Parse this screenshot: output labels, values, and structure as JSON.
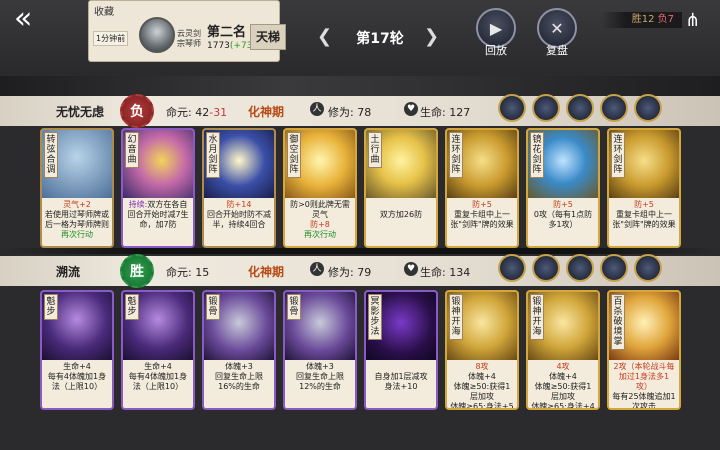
{
  "top": {
    "fav_label": "收藏",
    "time_ago": "1分钟前",
    "sect": "云灵剑宗琴师",
    "rank": "第二名",
    "score": "1773",
    "score_delta": "(+73)",
    "ladder": "天梯",
    "round": "第17轮",
    "replay_label": "回放",
    "review_label": "复盘",
    "record_win": "胜12",
    "record_loss": "负7"
  },
  "players": [
    {
      "name": "无忧无虑",
      "result": "负",
      "life_label": "命元:",
      "life": "42",
      "life_loss": "-31",
      "realm": "化神期",
      "cult_label": "修为:",
      "cult": "78",
      "hp_label": "生命:",
      "hp": "127",
      "cards": [
        {
          "name": "转弦合调",
          "d1": "灵气+2",
          "d2": "若使用过琴师牌或后一格为琴师牌则",
          "d3": "再次行动"
        },
        {
          "name": "幻音曲",
          "d1": "持续:",
          "d2": "双方在各自回合开始时减7生命，加7防"
        },
        {
          "name": "水月剑阵",
          "d1": "防+14",
          "d2": "回合开始时防不减半，持续4回合"
        },
        {
          "name": "御空剑阵",
          "lvl": "1",
          "d1": "防>0则此牌无需灵气",
          "d2": "防+8",
          "d3": "再次行动"
        },
        {
          "name": "土行曲",
          "d1": "双方加26防"
        },
        {
          "name": "连环剑阵",
          "d1": "防+5",
          "d2": "重复卡组中上一张\"剑阵\"牌的效果"
        },
        {
          "name": "镜花剑阵",
          "d1": "防+5",
          "d2": "0攻（每有1点防多1攻）"
        },
        {
          "name": "连环剑阵",
          "d1": "防+5",
          "d2": "重复卡组中上一张\"剑阵\"牌的效果"
        }
      ]
    },
    {
      "name": "溯流",
      "result": "胜",
      "life_label": "命元:",
      "life": "15",
      "realm": "化神期",
      "cult_label": "修为:",
      "cult": "79",
      "hp_label": "生命:",
      "hp": "134",
      "cards": [
        {
          "name": "魁步",
          "d1": "生命+4",
          "d2": "每有4体魄加1身法（上限10）"
        },
        {
          "name": "魁步",
          "d1": "生命+4",
          "d2": "每有4体魄加1身法（上限10）"
        },
        {
          "name": "锻骨",
          "d1": "体魄+3",
          "d2": "回复生命上限16%的生命"
        },
        {
          "name": "锻骨",
          "d1": "体魄+3",
          "d2": "回复生命上限12%的生命"
        },
        {
          "name": "冥影步法",
          "lvl": "1",
          "d1": "自身加1层减攻",
          "d2": "身法+10"
        },
        {
          "name": "锻神开海",
          "d1": "8攻",
          "d2": "体魄+4",
          "d3": "体魄≥50:获得1层加攻",
          "d4": "体魄≥65:身法+5"
        },
        {
          "name": "锻神开海",
          "d1": "4攻",
          "d2": "体魄+4",
          "d3": "体魄≥50:获得1层加攻",
          "d4": "体魄≥65:身法+4"
        },
        {
          "name": "百杀破境掌",
          "d1": "2攻（本轮战斗每加过1身法多1攻）",
          "d2": "每有25体魄追加1次攻击"
        }
      ]
    }
  ]
}
